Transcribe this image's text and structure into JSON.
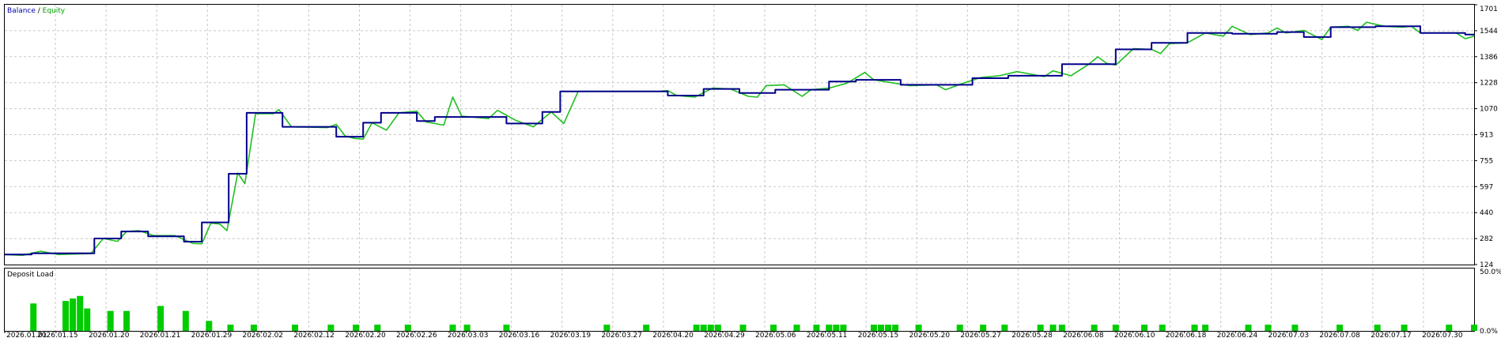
{
  "legend": {
    "balance": "Balance",
    "separator": " / ",
    "equity": "Equity"
  },
  "colors": {
    "balance": "#00008b",
    "equity": "#1fbf1f",
    "deposit_load": "#00cc00",
    "grid": "#c8c8c8",
    "frame": "#000000"
  },
  "chart_data": [
    {
      "type": "line",
      "title": "",
      "xlabel": "",
      "ylabel": "",
      "ylim": [
        124,
        1701
      ],
      "yticks": [
        "1701",
        "1544",
        "1386",
        "1228",
        "1070",
        "913",
        "755",
        "597",
        "440",
        "282",
        "124"
      ],
      "grid": true,
      "legend_position": "top-left",
      "series": [
        {
          "name": "Balance",
          "points": [
            [
              0.0,
              185
            ],
            [
              1.5,
              185
            ],
            [
              1.5,
              192
            ],
            [
              5.0,
              192
            ],
            [
              5.0,
              282
            ],
            [
              6.5,
              282
            ],
            [
              6.5,
              325
            ],
            [
              8.0,
              325
            ],
            [
              8.0,
              295
            ],
            [
              10.0,
              295
            ],
            [
              10.0,
              263
            ],
            [
              11.0,
              263
            ],
            [
              11.0,
              380
            ],
            [
              12.5,
              380
            ],
            [
              12.5,
              675
            ],
            [
              13.5,
              675
            ],
            [
              13.5,
              1045
            ],
            [
              15.5,
              1045
            ],
            [
              15.5,
              960
            ],
            [
              18.5,
              960
            ],
            [
              18.5,
              900
            ],
            [
              20.0,
              900
            ],
            [
              20.0,
              985
            ],
            [
              21.0,
              985
            ],
            [
              21.0,
              1045
            ],
            [
              23.0,
              1045
            ],
            [
              23.0,
              995
            ],
            [
              24.0,
              995
            ],
            [
              24.0,
              1020
            ],
            [
              28.0,
              1020
            ],
            [
              28.0,
              980
            ],
            [
              30.0,
              980
            ],
            [
              30.0,
              1050
            ],
            [
              31.0,
              1050
            ],
            [
              31.0,
              1175
            ],
            [
              37.0,
              1175
            ],
            [
              37.0,
              1150
            ],
            [
              39.0,
              1150
            ],
            [
              39.0,
              1190
            ],
            [
              41.0,
              1190
            ],
            [
              41.0,
              1165
            ],
            [
              43.0,
              1165
            ],
            [
              43.0,
              1185
            ],
            [
              46.0,
              1185
            ],
            [
              46.0,
              1235
            ],
            [
              47.5,
              1235
            ],
            [
              47.5,
              1245
            ],
            [
              50.0,
              1245
            ],
            [
              50.0,
              1215
            ],
            [
              54.0,
              1215
            ],
            [
              54.0,
              1255
            ],
            [
              56.0,
              1255
            ],
            [
              56.0,
              1270
            ],
            [
              59.0,
              1270
            ],
            [
              59.0,
              1340
            ],
            [
              62.0,
              1340
            ],
            [
              62.0,
              1430
            ],
            [
              64.0,
              1430
            ],
            [
              64.0,
              1470
            ],
            [
              66.0,
              1470
            ],
            [
              66.0,
              1530
            ],
            [
              68.5,
              1530
            ],
            [
              68.5,
              1525
            ],
            [
              71.0,
              1525
            ],
            [
              71.0,
              1535
            ],
            [
              72.5,
              1535
            ],
            [
              72.5,
              1505
            ],
            [
              74.0,
              1505
            ],
            [
              74.0,
              1565
            ],
            [
              76.5,
              1565
            ],
            [
              76.5,
              1570
            ],
            [
              79.0,
              1570
            ],
            [
              79.0,
              1530
            ],
            [
              81.5,
              1530
            ],
            [
              81.5,
              1520
            ],
            [
              82.0,
              1520
            ]
          ]
        },
        {
          "name": "Equity",
          "points": [
            [
              0.0,
              185
            ],
            [
              1.0,
              180
            ],
            [
              2.0,
              205
            ],
            [
              3.0,
              185
            ],
            [
              4.0,
              188
            ],
            [
              4.8,
              190
            ],
            [
              5.5,
              282
            ],
            [
              6.3,
              265
            ],
            [
              6.8,
              325
            ],
            [
              7.5,
              330
            ],
            [
              8.3,
              300
            ],
            [
              9.5,
              300
            ],
            [
              10.5,
              252
            ],
            [
              11.0,
              250
            ],
            [
              11.5,
              375
            ],
            [
              12.0,
              370
            ],
            [
              12.4,
              330
            ],
            [
              13.0,
              680
            ],
            [
              13.4,
              615
            ],
            [
              14.0,
              1040
            ],
            [
              15.0,
              1040
            ],
            [
              15.3,
              1065
            ],
            [
              16.0,
              960
            ],
            [
              18.0,
              955
            ],
            [
              18.5,
              975
            ],
            [
              19.0,
              905
            ],
            [
              19.5,
              890
            ],
            [
              20.0,
              885
            ],
            [
              20.5,
              985
            ],
            [
              21.3,
              940
            ],
            [
              22.0,
              1045
            ],
            [
              23.0,
              1055
            ],
            [
              23.5,
              990
            ],
            [
              24.5,
              970
            ],
            [
              25.0,
              1140
            ],
            [
              25.5,
              1025
            ],
            [
              27.0,
              1010
            ],
            [
              27.5,
              1060
            ],
            [
              28.5,
              1000
            ],
            [
              29.5,
              960
            ],
            [
              30.5,
              1050
            ],
            [
              31.2,
              980
            ],
            [
              32.0,
              1175
            ],
            [
              36.5,
              1175
            ],
            [
              37.0,
              1180
            ],
            [
              37.5,
              1150
            ],
            [
              38.5,
              1140
            ],
            [
              39.5,
              1195
            ],
            [
              40.5,
              1190
            ],
            [
              41.5,
              1145
            ],
            [
              42.0,
              1140
            ],
            [
              42.5,
              1210
            ],
            [
              43.5,
              1215
            ],
            [
              44.5,
              1145
            ],
            [
              45.0,
              1185
            ],
            [
              46.0,
              1195
            ],
            [
              47.0,
              1225
            ],
            [
              48.0,
              1290
            ],
            [
              48.5,
              1245
            ],
            [
              50.5,
              1210
            ],
            [
              52.0,
              1215
            ],
            [
              52.5,
              1185
            ],
            [
              53.5,
              1225
            ],
            [
              54.5,
              1260
            ],
            [
              55.5,
              1270
            ],
            [
              56.5,
              1295
            ],
            [
              57.5,
              1275
            ],
            [
              58.0,
              1265
            ],
            [
              58.5,
              1300
            ],
            [
              59.5,
              1270
            ],
            [
              60.5,
              1340
            ],
            [
              61.0,
              1385
            ],
            [
              61.5,
              1345
            ],
            [
              62.0,
              1335
            ],
            [
              63.0,
              1435
            ],
            [
              64.0,
              1430
            ],
            [
              64.5,
              1405
            ],
            [
              65.0,
              1465
            ],
            [
              66.0,
              1470
            ],
            [
              67.0,
              1530
            ],
            [
              67.5,
              1520
            ],
            [
              68.0,
              1510
            ],
            [
              68.5,
              1570
            ],
            [
              69.5,
              1520
            ],
            [
              70.5,
              1530
            ],
            [
              71.0,
              1560
            ],
            [
              71.5,
              1530
            ],
            [
              72.5,
              1545
            ],
            [
              73.5,
              1490
            ],
            [
              74.0,
              1565
            ],
            [
              75.0,
              1570
            ],
            [
              75.5,
              1545
            ],
            [
              76.0,
              1595
            ],
            [
              77.0,
              1570
            ],
            [
              78.0,
              1565
            ],
            [
              78.5,
              1570
            ],
            [
              79.0,
              1530
            ],
            [
              80.0,
              1530
            ],
            [
              81.0,
              1530
            ],
            [
              81.5,
              1495
            ],
            [
              82.0,
              1510
            ]
          ]
        }
      ]
    },
    {
      "type": "bar",
      "title": "Deposit Load",
      "ylim": [
        0,
        50
      ],
      "yticks": [
        "50.0%",
        "0.0%"
      ],
      "xlabels": [
        "2026.01.01",
        "2026.01.15",
        "2026.01.20",
        "2026.01.21",
        "2026.01.29",
        "2026.02.02",
        "2026.02.12",
        "2026.02.20",
        "2026.02.26",
        "2026.03.03",
        "2026.03.16",
        "2026.03.19",
        "2026.03.27",
        "2026.04.20",
        "2026.04.29",
        "2026.05.06",
        "2026.05.11",
        "2026.05.15",
        "2026.05.20",
        "2026.05.27",
        "2026.05.28",
        "2026.06.08",
        "2026.06.10",
        "2026.06.18",
        "2026.06.24",
        "2026.07.03",
        "2026.07.08",
        "2026.07.17",
        "2026.07.30"
      ],
      "bars": [
        [
          1.6,
          22
        ],
        [
          3.4,
          24
        ],
        [
          3.8,
          26
        ],
        [
          4.2,
          28
        ],
        [
          4.6,
          18
        ],
        [
          5.9,
          16
        ],
        [
          6.8,
          16
        ],
        [
          8.7,
          20
        ],
        [
          10.1,
          16
        ],
        [
          11.4,
          8
        ],
        [
          12.6,
          5
        ],
        [
          13.9,
          5
        ],
        [
          16.2,
          5
        ],
        [
          18.2,
          5
        ],
        [
          19.6,
          5
        ],
        [
          20.8,
          5
        ],
        [
          22.5,
          5
        ],
        [
          25.0,
          5
        ],
        [
          25.8,
          5
        ],
        [
          28.0,
          5
        ],
        [
          33.6,
          5
        ],
        [
          35.8,
          5
        ],
        [
          38.6,
          5
        ],
        [
          39.0,
          5
        ],
        [
          39.4,
          5
        ],
        [
          39.8,
          5
        ],
        [
          41.2,
          5
        ],
        [
          42.9,
          5
        ],
        [
          44.2,
          5
        ],
        [
          45.3,
          5
        ],
        [
          46.0,
          5
        ],
        [
          46.4,
          5
        ],
        [
          46.8,
          5
        ],
        [
          48.5,
          5
        ],
        [
          48.9,
          5
        ],
        [
          49.3,
          5
        ],
        [
          49.7,
          5
        ],
        [
          51.0,
          5
        ],
        [
          53.3,
          5
        ],
        [
          54.6,
          5
        ],
        [
          55.8,
          5
        ],
        [
          57.8,
          5
        ],
        [
          58.5,
          5
        ],
        [
          59.0,
          5
        ],
        [
          60.8,
          5
        ],
        [
          62.0,
          5
        ],
        [
          63.6,
          5
        ],
        [
          64.6,
          5
        ],
        [
          66.4,
          5
        ],
        [
          67.0,
          5
        ],
        [
          69.4,
          5
        ],
        [
          70.5,
          5
        ],
        [
          72.0,
          5
        ],
        [
          74.5,
          5
        ],
        [
          76.6,
          5
        ],
        [
          78.1,
          5
        ],
        [
          80.6,
          5
        ],
        [
          82.0,
          5
        ]
      ]
    }
  ]
}
